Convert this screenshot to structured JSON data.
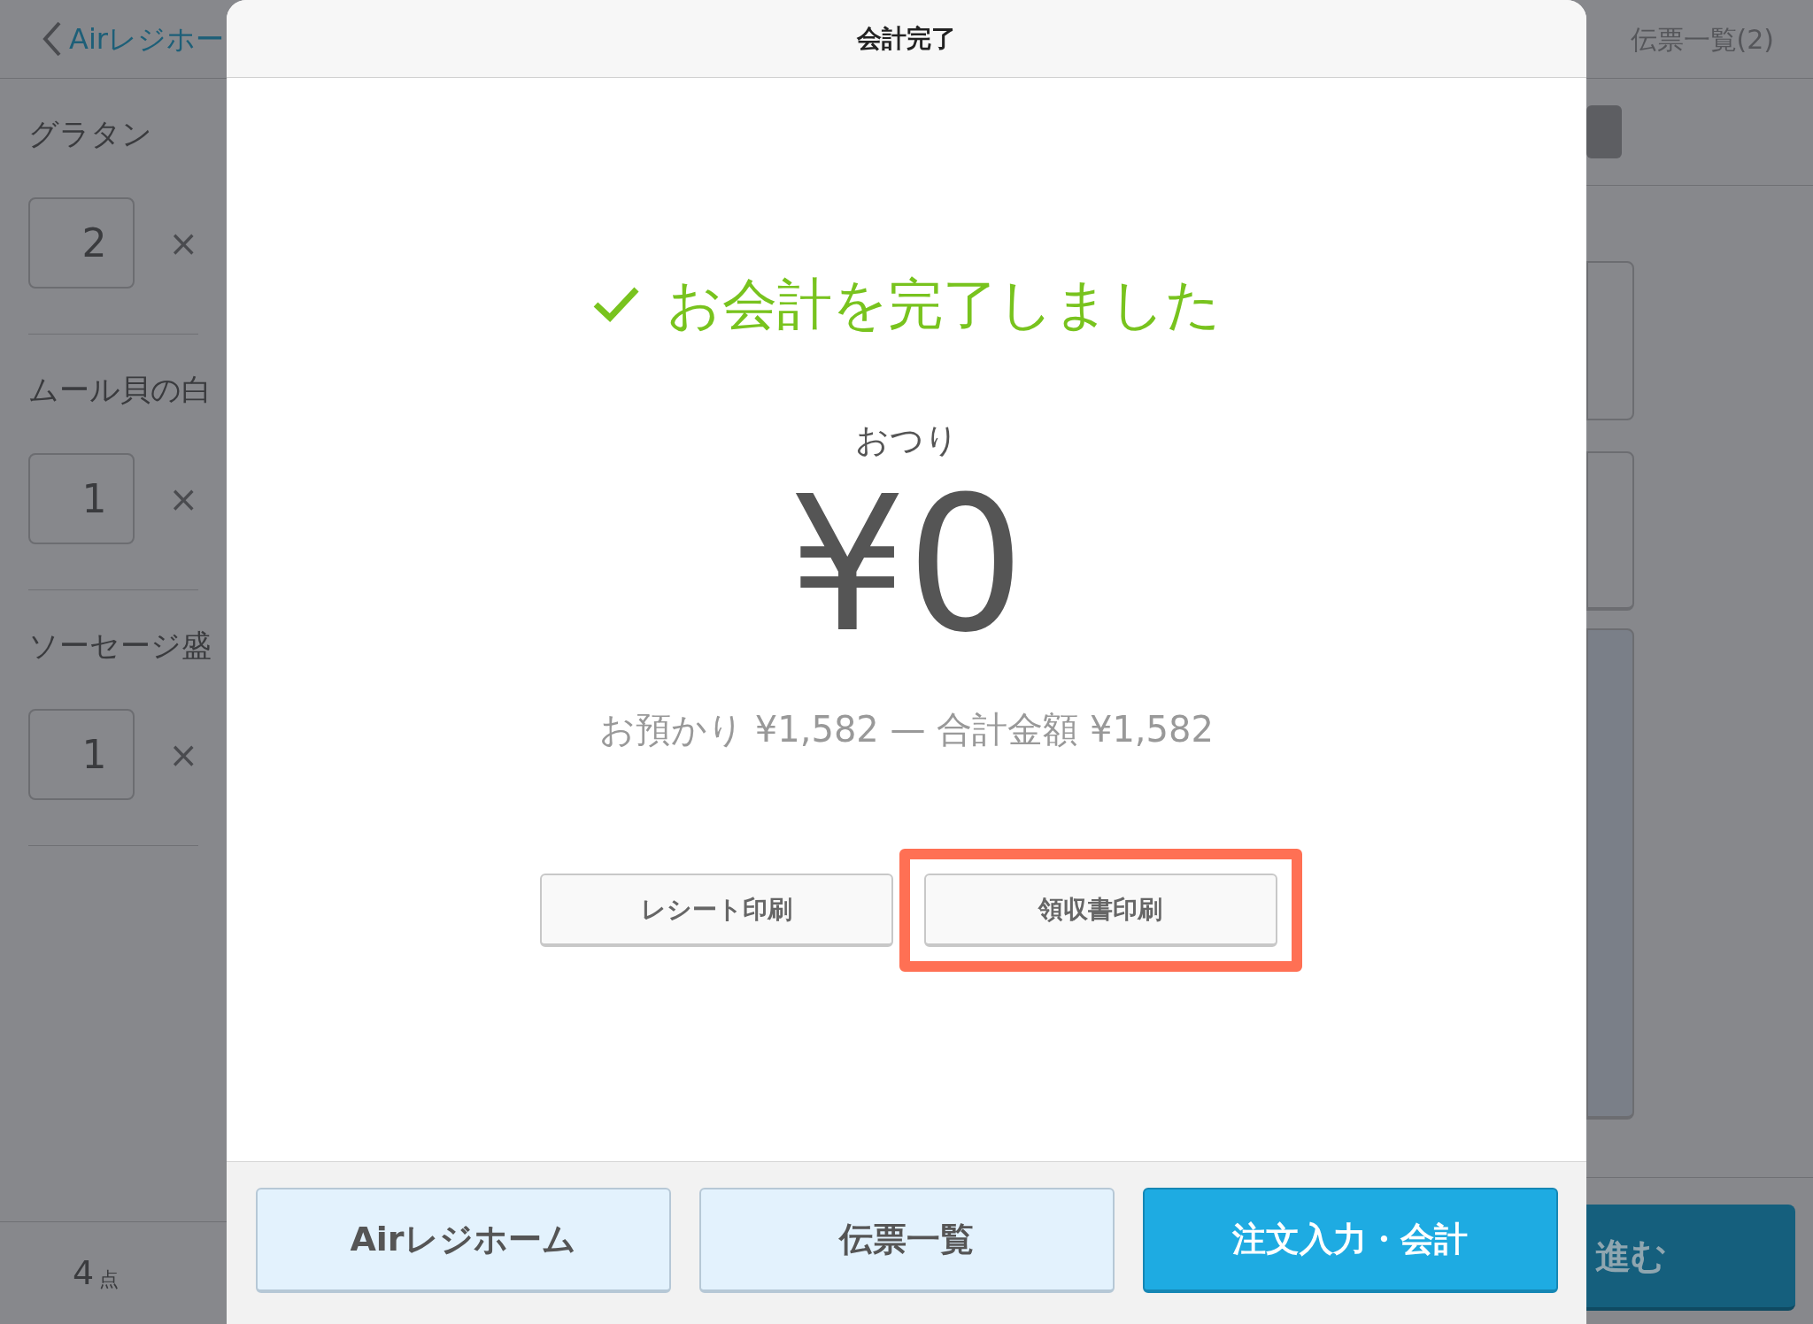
{
  "background": {
    "left_panel": {
      "back_link": "Airレジホー",
      "items": [
        {
          "name": "グラタン",
          "quantity": "2",
          "remove": "×"
        },
        {
          "name": "ムール貝の白",
          "quantity": "1",
          "remove": "×"
        },
        {
          "name": "ソーセージ盛",
          "quantity": "1",
          "remove": "×"
        }
      ],
      "total_count": "4",
      "total_unit": "点"
    },
    "right_panel": {
      "title": "伝票一覧(2)",
      "next_button": "進む"
    }
  },
  "dialog": {
    "title": "会計完了",
    "status": "お会計を完了しました",
    "change_label": "おつり",
    "change_amount": "¥0",
    "summary": "お預かり ¥1,582 — 合計金額 ¥1,582",
    "print_buttons": [
      {
        "label": "レシート印刷",
        "highlighted": false
      },
      {
        "label": "領収書印刷",
        "highlighted": true
      }
    ],
    "footer_buttons": [
      {
        "label": "Airレジホーム",
        "kind": "secondary"
      },
      {
        "label": "伝票一覧",
        "kind": "secondary"
      },
      {
        "label": "注文入力・会計",
        "kind": "primary"
      }
    ]
  }
}
